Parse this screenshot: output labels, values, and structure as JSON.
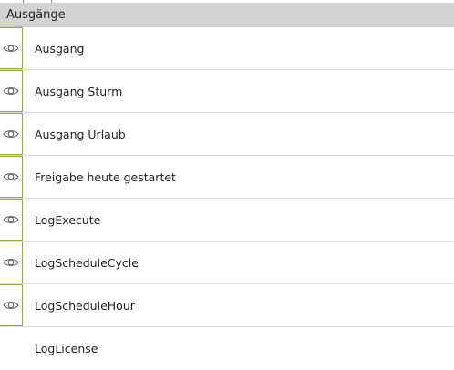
{
  "header": {
    "title": "Ausgänge"
  },
  "items": [
    {
      "label": "Ausgang",
      "has_eye": true,
      "icon": "eye-icon"
    },
    {
      "label": "Ausgang Sturm",
      "has_eye": true,
      "icon": "eye-icon"
    },
    {
      "label": "Ausgang Urlaub",
      "has_eye": true,
      "icon": "eye-icon"
    },
    {
      "label": "Freigabe heute gestartet",
      "has_eye": true,
      "icon": "eye-icon"
    },
    {
      "label": "LogExecute",
      "has_eye": true,
      "icon": "eye-icon"
    },
    {
      "label": "LogScheduleCycle",
      "has_eye": true,
      "icon": "eye-icon"
    },
    {
      "label": "LogScheduleHour",
      "has_eye": true,
      "icon": "eye-icon"
    },
    {
      "label": "LogLicense",
      "has_eye": false
    }
  ],
  "colors": {
    "header_bg": "#d3d3d3",
    "accent_border": "#9aa838",
    "divider": "#dcdcdc",
    "eye_stroke": "#555555"
  }
}
